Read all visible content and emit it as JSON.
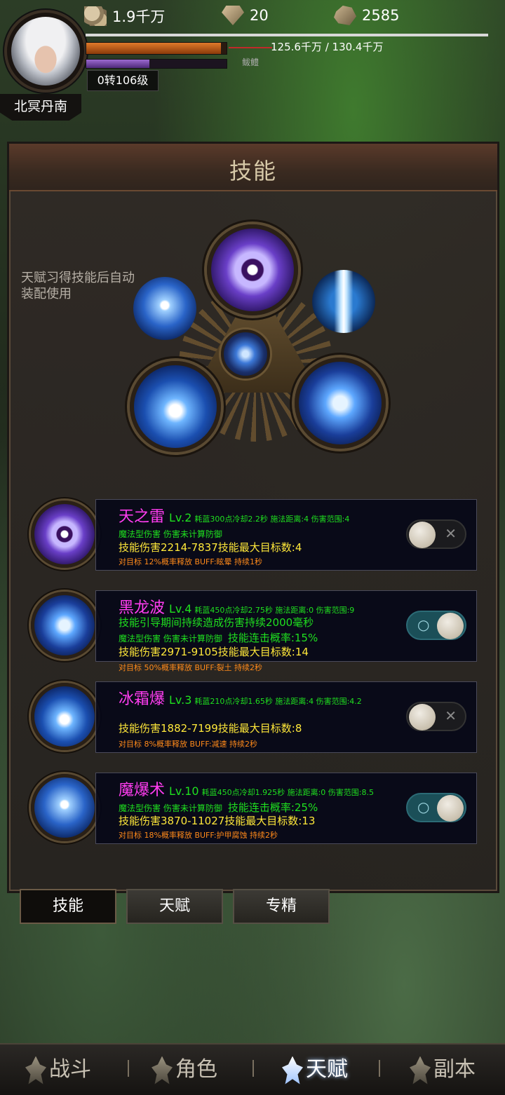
{
  "hud": {
    "coins": "1.9千万",
    "gems": "20",
    "ore": "2585",
    "hp_text": "125.6千万 / 130.4千万",
    "level_text": "0转106级",
    "player_name": "北冥丹南",
    "target_name": "鲅鳢"
  },
  "panel": {
    "title": "技能",
    "hint": "天赋习得技能后自动装配使用"
  },
  "skills": [
    {
      "name": "天之雷",
      "level": "Lv.2",
      "info": "耗蓝300点冷却2.2秒 施法距离:4 伤害范围:4",
      "line2a": "魔法型伤害  伤害未计算防御",
      "line2b": "",
      "line3": "技能伤害2214-7837技能最大目标数:4",
      "line4": "对目标 12%概率释放 BUFF:眩晕 持续1秒",
      "enabled": false
    },
    {
      "name": "黑龙波",
      "level": "Lv.4",
      "info": "耗蓝450点冷却2.75秒 施法距离:0 伤害范围:9",
      "line_extra": "技能引导期间持续造成伤害持续2000毫秒",
      "line2a": "魔法型伤害  伤害未计算防御",
      "line2b": "技能连击概率:15%",
      "line3": "技能伤害2971-9105技能最大目标数:14",
      "line4": "对目标 50%概率释放 BUFF:裂土 持续2秒",
      "enabled": true
    },
    {
      "name": "冰霜爆",
      "level": "Lv.3",
      "info": "耗蓝210点冷却1.65秒 施法距离:4 伤害范围:4.2",
      "line2a": "",
      "line2b": "",
      "line3": "技能伤害1882-7199技能最大目标数:8",
      "line4": "对目标 8%概率释放 BUFF:减速 持续2秒",
      "enabled": false
    },
    {
      "name": "魔爆术",
      "level": "Lv.10",
      "info": "耗蓝450点冷却1.925秒 施法距离:0 伤害范围:8.5",
      "line2a": "魔法型伤害  伤害未计算防御",
      "line2b": "技能连击概率:25%",
      "line3": "技能伤害3870-11027技能最大目标数:13",
      "line4": "对目标 18%概率释放 BUFF:护甲腐蚀 持续2秒",
      "enabled": true
    }
  ],
  "tabs": [
    "技能",
    "天赋",
    "专精"
  ],
  "nav": [
    "战斗",
    "角色",
    "天赋",
    "副本"
  ],
  "toggle_marks": {
    "on": "○",
    "off": "✕"
  },
  "colors": {
    "skill_name": "#ff3df0",
    "green_text": "#1fe01f",
    "yellow_text": "#ffe83a",
    "orange_text": "#ff8a1a"
  }
}
